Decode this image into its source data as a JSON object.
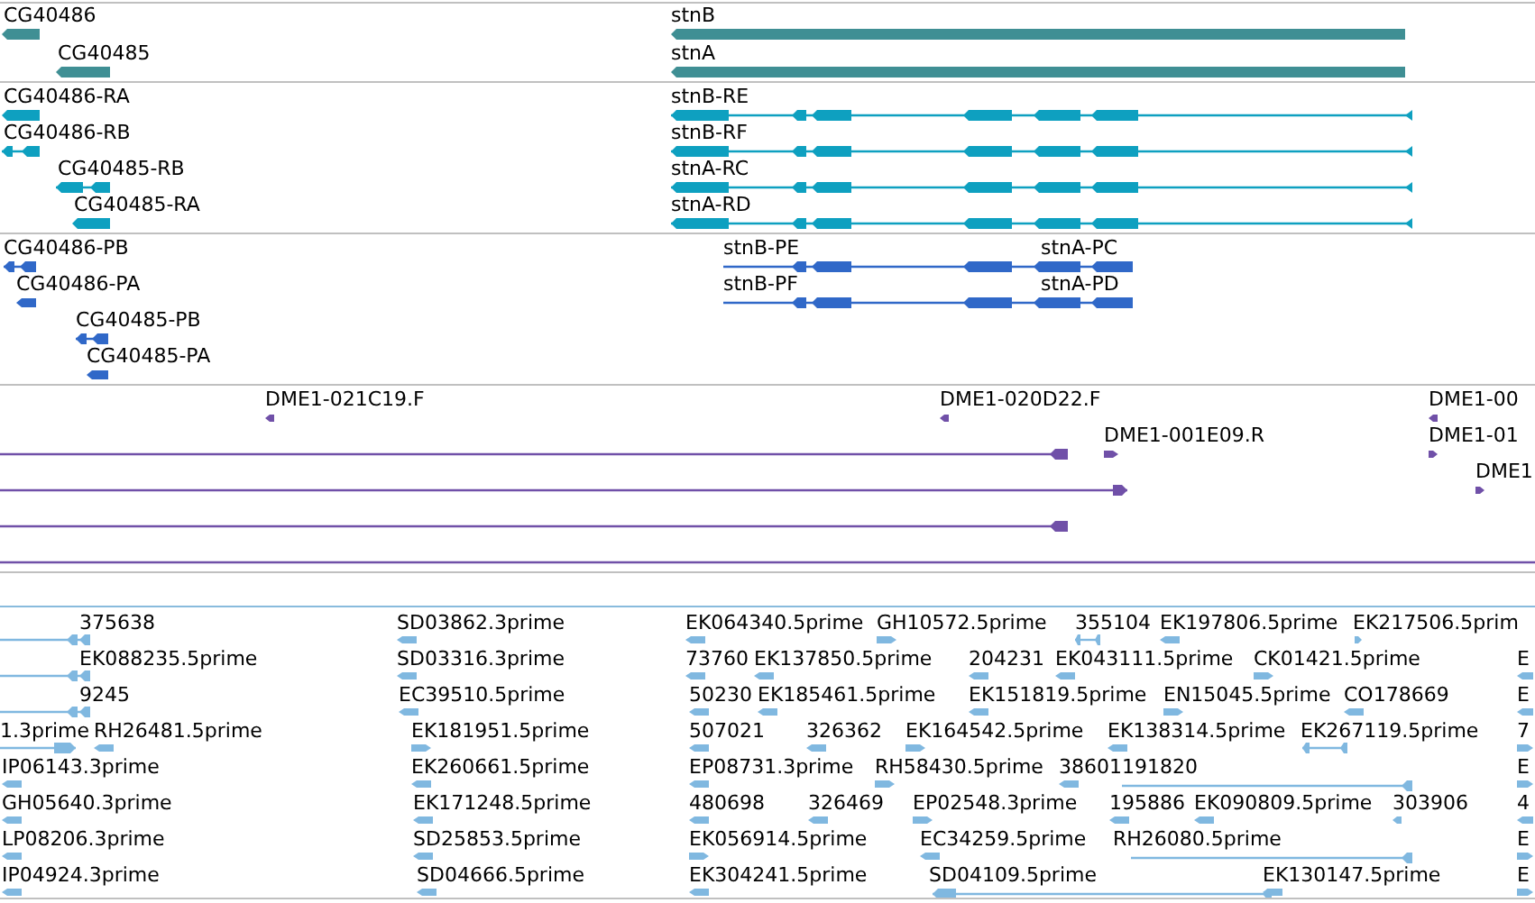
{
  "tracks": [
    {
      "color": "#3f8f94",
      "features": [
        {
          "label": "CG40486"
        },
        {
          "label": "CG40485"
        },
        {
          "label": "stnB"
        },
        {
          "label": "stnA"
        }
      ]
    },
    {
      "color": "#0ea0c0",
      "features": [
        {
          "label": "CG40486-RA"
        },
        {
          "label": "CG40486-RB"
        },
        {
          "label": "CG40485-RB"
        },
        {
          "label": "CG40485-RA"
        },
        {
          "label": "stnB-RE"
        },
        {
          "label": "stnB-RF"
        },
        {
          "label": "stnA-RC"
        },
        {
          "label": "stnA-RD"
        }
      ]
    },
    {
      "color": "#3068c8",
      "features": [
        {
          "label": "CG40486-PB"
        },
        {
          "label": "CG40486-PA"
        },
        {
          "label": "CG40485-PB"
        },
        {
          "label": "CG40485-PA"
        },
        {
          "label": "stnB-PE"
        },
        {
          "label": "stnA-PC"
        },
        {
          "label": "stnB-PF"
        },
        {
          "label": "stnA-PD"
        }
      ]
    },
    {
      "color": "#7050a8",
      "features": [
        {
          "label": "DME1-021C19.F"
        },
        {
          "label": "DME1-020D22.F"
        },
        {
          "label": "DME1-00"
        },
        {
          "label": "DME1-001E09.R"
        },
        {
          "label": "DME1-01"
        },
        {
          "label": "DME1"
        }
      ]
    },
    {
      "color": "#80b8e0",
      "features": [
        {
          "label": "375638"
        },
        {
          "label": "SD03862.3prime"
        },
        {
          "label": "EK064340.5prime"
        },
        {
          "label": "GH10572.5prime"
        },
        {
          "label": "355104"
        },
        {
          "label": "EK197806.5prime"
        },
        {
          "label": "EK217506.5prim"
        },
        {
          "label": "EK088235.5prime"
        },
        {
          "label": "SD03316.3prime"
        },
        {
          "label": "73760"
        },
        {
          "label": "EK137850.5prime"
        },
        {
          "label": "204231"
        },
        {
          "label": "EK043111.5prime"
        },
        {
          "label": "CK01421.5prime"
        },
        {
          "label": "E"
        },
        {
          "label": "9245"
        },
        {
          "label": "EC39510.5prime"
        },
        {
          "label": "50230"
        },
        {
          "label": "EK185461.5prime"
        },
        {
          "label": "EK151819.5prime"
        },
        {
          "label": "EN15045.5prime"
        },
        {
          "label": "CO178669"
        },
        {
          "label": "E"
        },
        {
          "label": "1.3prime"
        },
        {
          "label": "RH26481.5prime"
        },
        {
          "label": "EK181951.5prime"
        },
        {
          "label": "507021"
        },
        {
          "label": "326362"
        },
        {
          "label": "EK164542.5prime"
        },
        {
          "label": "EK138314.5prime"
        },
        {
          "label": "EK267119.5prime"
        },
        {
          "label": "7"
        },
        {
          "label": "IP06143.3prime"
        },
        {
          "label": "EK260661.5prime"
        },
        {
          "label": "EP08731.3prime"
        },
        {
          "label": "RH58430.5prime"
        },
        {
          "label": "38601"
        },
        {
          "label": "191820"
        },
        {
          "label": "E"
        },
        {
          "label": "GH05640.3prime"
        },
        {
          "label": "EK171248.5prime"
        },
        {
          "label": "480698"
        },
        {
          "label": "326469"
        },
        {
          "label": "EP02548.3prime"
        },
        {
          "label": "195886"
        },
        {
          "label": "EK090809.5prime"
        },
        {
          "label": "303906"
        },
        {
          "label": "4"
        },
        {
          "label": "LP08206.3prime"
        },
        {
          "label": "SD25853.5prime"
        },
        {
          "label": "EK056914.5prime"
        },
        {
          "label": "EC34259.5prime"
        },
        {
          "label": "RH26080.5prime"
        },
        {
          "label": "E"
        },
        {
          "label": "IP04924.3prime"
        },
        {
          "label": "SD04666.5prime"
        },
        {
          "label": "EK304241.5prime"
        },
        {
          "label": "SD04109.5prime"
        },
        {
          "label": "EK130147.5prime"
        },
        {
          "label": "E"
        }
      ]
    }
  ]
}
